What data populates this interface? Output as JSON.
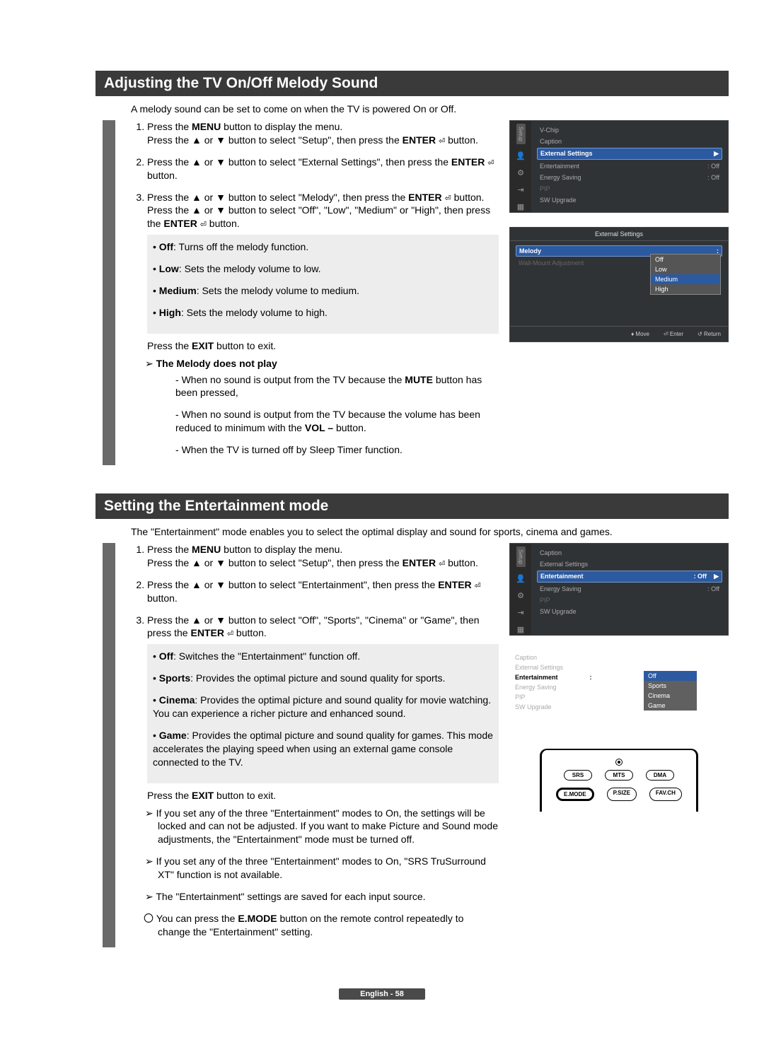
{
  "page_number_label": "English - 58",
  "section1": {
    "title": "Adjusting the TV On/Off Melody Sound",
    "intro": "A melody sound can be set to come on when the TV is powered On or Off.",
    "steps": {
      "s1a": "Press the ",
      "s1b": "MENU",
      "s1c": " button to display the menu.",
      "s1d": "Press the ▲ or ▼ button to select \"Setup\", then press the ",
      "s1e": "ENTER",
      "s1f": " button.",
      "s2a": "Press the ▲ or ▼ button to select \"External Settings\", then press the ",
      "s2b": "ENTER",
      "s2c": " button.",
      "s3a": "Press the ▲ or ▼ button to select \"Melody\", then press the ",
      "s3b": "ENTER",
      "s3c": " button.",
      "s3d": "Press the ▲ or ▼ button to select \"Off\", \"Low\", \"Medium\" or \"High\", then press the ",
      "s3e": "ENTER",
      "s3f": " button."
    },
    "bullets": {
      "b1a": "Off",
      "b1b": ": Turns off the melody function.",
      "b2a": "Low",
      "b2b": ": Sets the melody volume to low.",
      "b3a": "Medium",
      "b3b": ": Sets the melody volume to medium.",
      "b4a": "High",
      "b4b": ": Sets the melody volume to high."
    },
    "exit_a": "Press the ",
    "exit_b": "EXIT",
    "exit_c": " button to exit.",
    "noplay_title": "The Melody does not play",
    "noplay": {
      "n1a": "When no sound is output from the TV because the ",
      "n1b": "MUTE",
      "n1c": " button has been pressed,",
      "n2a": "When no sound is output from the TV because the volume has been reduced to minimum with the ",
      "n2b": "VOL –",
      "n2c": " button.",
      "n3": "When the TV is turned off by Sleep Timer function."
    },
    "tv1": {
      "sidebar": "Setup",
      "items": [
        "V-Chip",
        "Caption",
        "External Settings",
        "Entertainment",
        "Energy Saving",
        "PIP",
        "SW Upgrade"
      ],
      "vals": {
        "Entertainment": ": Off",
        "Energy Saving": ": Off"
      },
      "sel": "External Settings",
      "arrow": "▶"
    },
    "tv2": {
      "title": "External Settings",
      "items": [
        "Melody",
        "Wall-Mount Adjustment"
      ],
      "sel": "Melody",
      "popup": [
        "Off",
        "Low",
        "Medium",
        "High"
      ],
      "psel": "Medium",
      "footer": {
        "move": "Move",
        "enter": "Enter",
        "return": "Return"
      }
    }
  },
  "section2": {
    "title": "Setting the Entertainment mode",
    "intro": "The \"Entertainment\" mode enables you to select the optimal display and sound for sports, cinema and games.",
    "steps": {
      "s1a": "Press the ",
      "s1b": "MENU",
      "s1c": " button to display the menu.",
      "s1d": "Press the ▲ or ▼ button to select \"Setup\", then press the ",
      "s1e": "ENTER",
      "s1f": " button.",
      "s2a": "Press the ▲ or ▼ button to select \"Entertainment\", then press the ",
      "s2b": "ENTER",
      "s2c": " button.",
      "s3a": "Press the ▲ or ▼ button to select \"Off\", \"Sports\", \"Cinema\" or \"Game\", then press the ",
      "s3b": "ENTER",
      "s3c": " button."
    },
    "bullets": {
      "b1a": "Off",
      "b1b": ": Switches the \"Entertainment\" function off.",
      "b2a": "Sports",
      "b2b": ": Provides the optimal picture and sound quality for sports.",
      "b3a": "Cinema",
      "b3b": ": Provides the optimal picture and sound quality for movie watching. You can experience a richer picture and enhanced sound.",
      "b4a": "Game",
      "b4b": ": Provides the optimal picture and sound quality for games. This mode accelerates the playing speed when using an external game console connected to the TV."
    },
    "exit_a": "Press the ",
    "exit_b": "EXIT",
    "exit_c": " button to exit.",
    "notes": {
      "n1": "If you set any of the three \"Entertainment\" modes to On, the settings will be locked and can not be adjusted. If you want to make Picture and Sound mode adjustments, the \"Entertainment\" mode must be turned off.",
      "n2": "If you set any of the three \"Entertainment\" modes to On, \"SRS TruSurround XT\" function is not available.",
      "n3": "The \"Entertainment\" settings are saved for each input source."
    },
    "note_o_a": "You can press the ",
    "note_o_b": "E.MODE",
    "note_o_c": " button on the remote control repeatedly to change the \"Entertainment\" setting.",
    "tv1": {
      "sidebar": "Setup",
      "items": [
        "Caption",
        "External Settings",
        "Entertainment",
        "Energy Saving",
        "PIP",
        "SW Upgrade"
      ],
      "vals": {
        "Entertainment": ": Off",
        "Energy Saving": ": Off"
      },
      "sel": "Entertainment",
      "arrow": "▶"
    },
    "tv2": {
      "items": [
        "Caption",
        "External Settings",
        "Entertainment",
        "Energy Saving",
        "PIP",
        "SW Upgrade"
      ],
      "sel": "Entertainment",
      "selval": ":",
      "popup": [
        "Off",
        "Sports",
        "Cinema",
        "Game"
      ],
      "psel": "Off"
    },
    "remote": {
      "row1": [
        "SRS",
        "MTS",
        "DMA"
      ],
      "row2": [
        "E.MODE",
        "P.SIZE",
        "FAV.CH"
      ],
      "sel": "E.MODE"
    }
  }
}
